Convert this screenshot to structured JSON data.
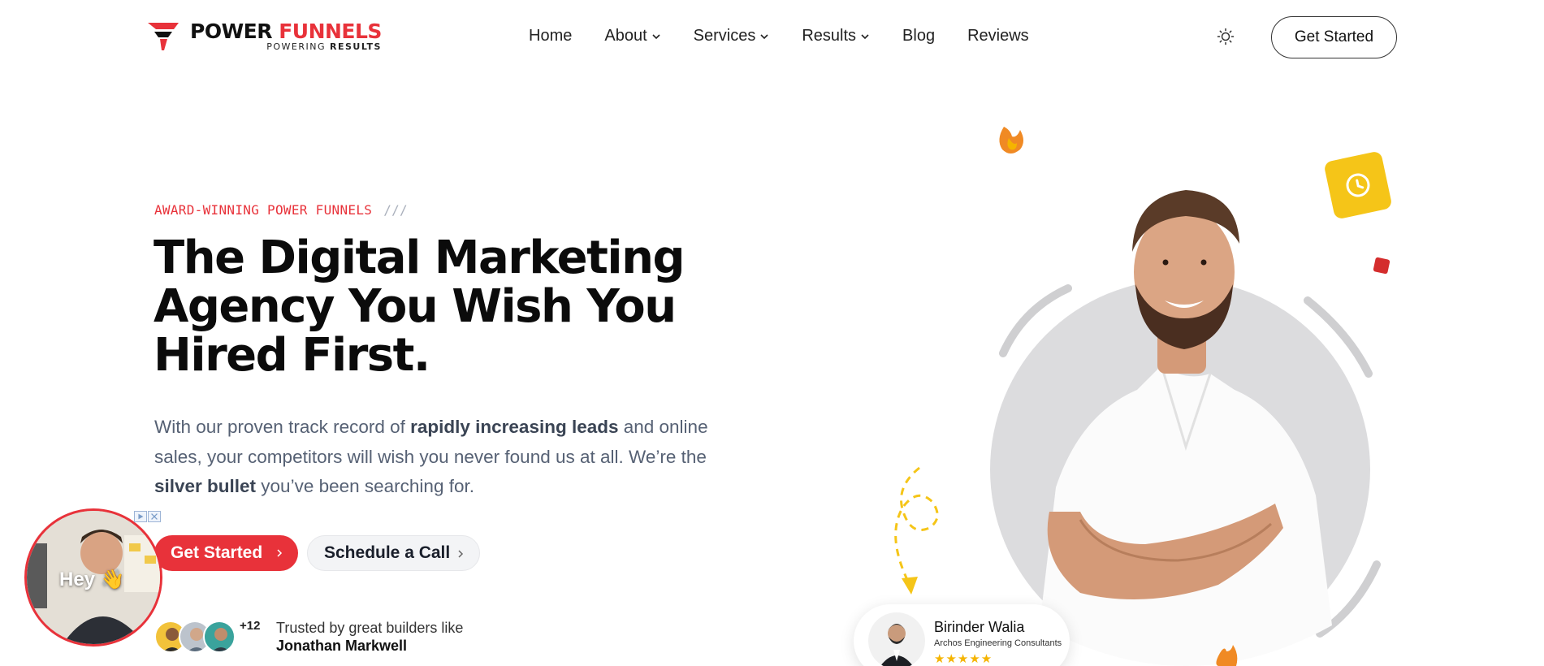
{
  "brand": {
    "title_part1": "POWER",
    "title_part2": "FUNNELS",
    "tagline_part1": "POWERING",
    "tagline_part2": "RESULTS",
    "accent_color": "#e8323a"
  },
  "nav": {
    "items": [
      {
        "label": "Home",
        "has_dropdown": false
      },
      {
        "label": "About",
        "has_dropdown": true
      },
      {
        "label": "Services",
        "has_dropdown": true
      },
      {
        "label": "Results",
        "has_dropdown": true
      },
      {
        "label": "Blog",
        "has_dropdown": false
      },
      {
        "label": "Reviews",
        "has_dropdown": false
      }
    ],
    "theme_icon": "sun-icon",
    "cta_label": "Get Started"
  },
  "hero": {
    "eyebrow": "AWARD-WINNING POWER FUNNELS",
    "eyebrow_decoration": "///",
    "headline_line1": "The Digital Marketing",
    "headline_line2": "Agency You Wish You",
    "headline_line3": "Hired First.",
    "lead_part1": "With our proven track record of ",
    "lead_bold1": "rapidly increasing leads",
    "lead_part2": " and online sales, your competitors will wish you never found us at all. We’re the ",
    "lead_bold2": "silver bullet",
    "lead_part3": " you’ve been searching for.",
    "primary_button": "Get Started",
    "secondary_button": "Schedule a Call",
    "trust_count": "+12",
    "trust_text": "Trusted by great builders like",
    "trust_name": "Jonathan Markwell"
  },
  "video_bubble": {
    "caption": "Hey",
    "emoji": "👋"
  },
  "review_card": {
    "name": "Birinder Walia",
    "company": "Archos Engineering Consultants",
    "stars": "★★★★★",
    "rating": 5
  }
}
